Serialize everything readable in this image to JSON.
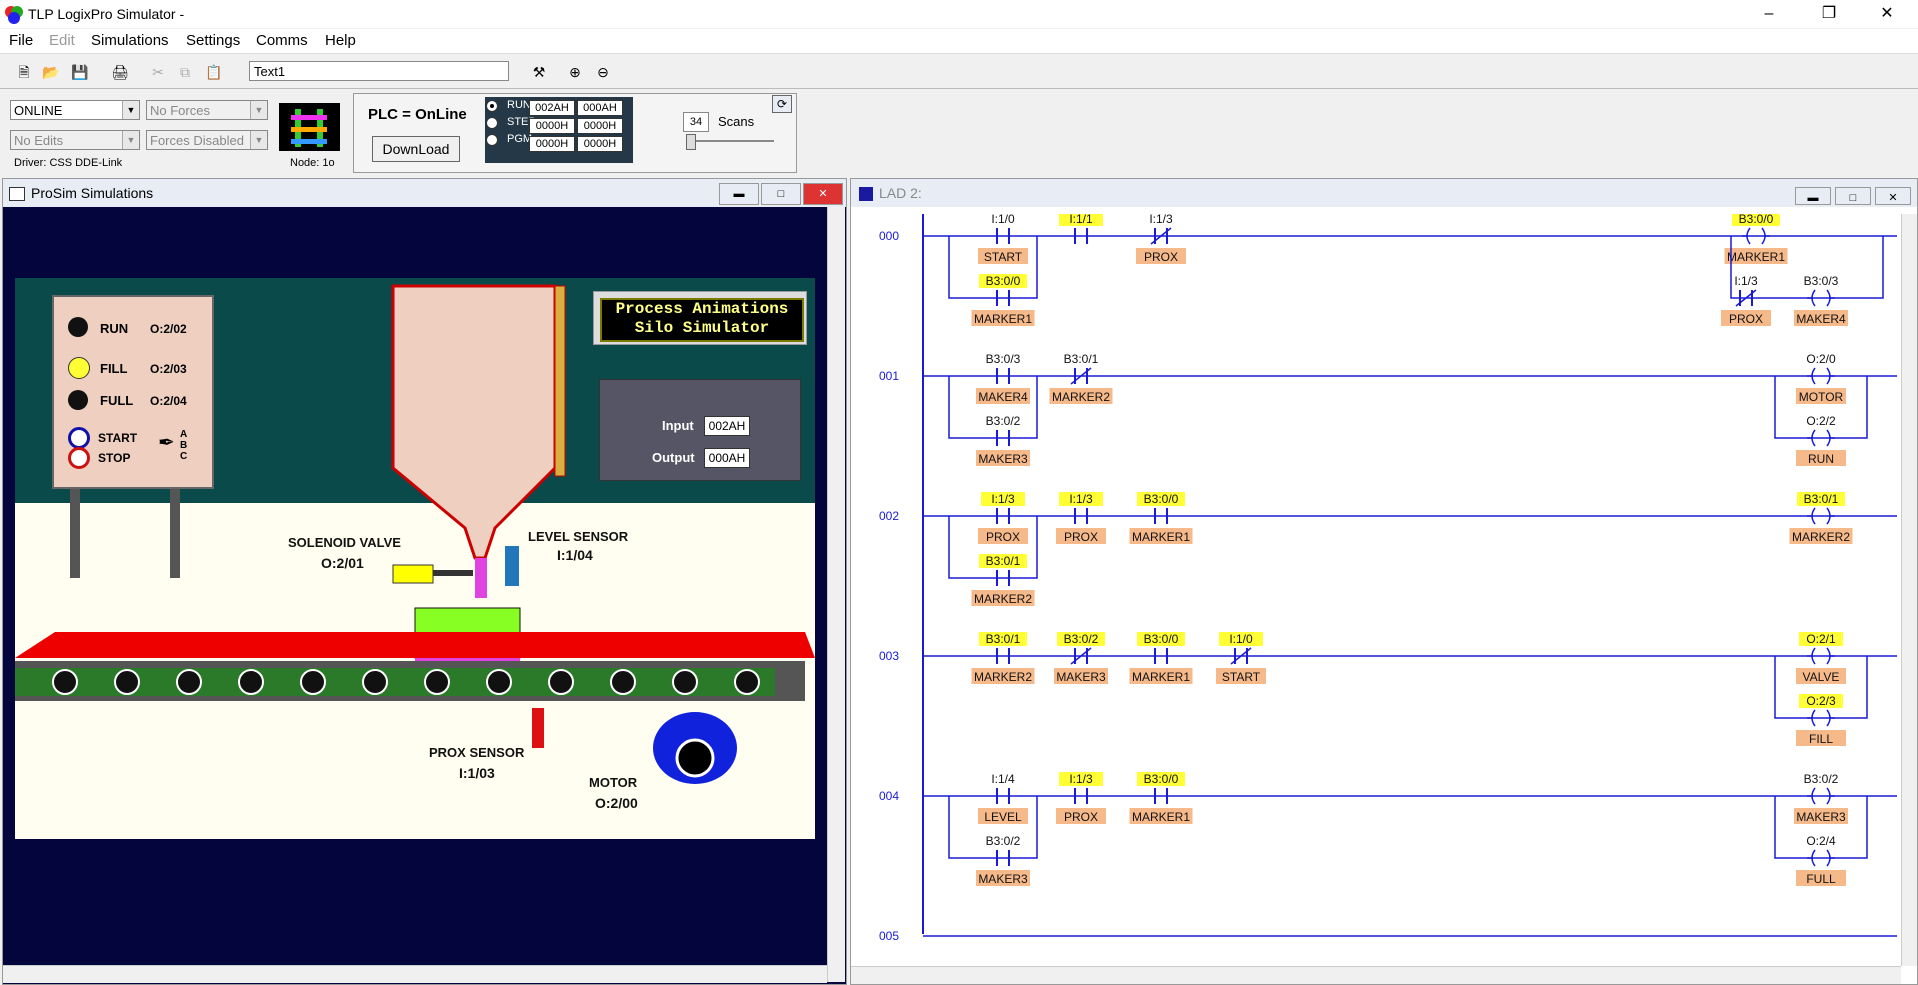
{
  "app": {
    "title": "TLP LogixPro Simulator  -"
  },
  "menu": [
    "File",
    "Edit",
    "Simulations",
    "Settings",
    "Comms",
    "Help"
  ],
  "toolbar": {
    "text_field": "Text1"
  },
  "control": {
    "mode_value": "ONLINE",
    "edits_value": "No Edits",
    "forces_value": "No Forces",
    "forces_enabled_value": "Forces Disabled",
    "driver": "Driver:  CSS DDE-Link",
    "node": "Node: 1o",
    "plc_status": "PLC = OnLine",
    "download_label": "DownLoad",
    "run_label": "RUN",
    "step_label": "STEP",
    "pgm_label": "PGM",
    "hex": [
      "002AH",
      "000AH",
      "0000H",
      "0000H",
      "0000H",
      "0000H"
    ],
    "scans_value": "34",
    "scans_label": "Scans"
  },
  "prosim": {
    "title": "ProSim Simulations",
    "banner_line1": "Process Animations",
    "banner_line2": "Silo Simulator",
    "lamps": [
      {
        "label": "RUN",
        "addr": "O:2/02",
        "color": "#111111"
      },
      {
        "label": "FILL",
        "addr": "O:2/03",
        "color": "#ffff33"
      },
      {
        "label": "FULL",
        "addr": "O:2/04",
        "color": "#111111"
      }
    ],
    "start_label": "START",
    "stop_label": "STOP",
    "abc": "A\nB\nC",
    "input_label": "Input",
    "input_value": "002AH",
    "output_label": "Output",
    "output_value": "000AH",
    "solenoid_label": "SOLENOID VALVE",
    "solenoid_addr": "O:2/01",
    "level_label": "LEVEL SENSOR",
    "level_addr": "I:1/04",
    "prox_label": "PROX SENSOR",
    "prox_addr": "I:1/03",
    "motor_label": "MOTOR",
    "motor_addr": "O:2/00"
  },
  "lad": {
    "title": "LAD 2:",
    "rungs": [
      {
        "num": "000",
        "contacts": [
          {
            "addr": "I:1/0",
            "name": "START",
            "type": "NO",
            "hl": false
          },
          {
            "addr": "I:1/1",
            "name": "",
            "type": "NO",
            "hl": true
          },
          {
            "addr": "B3:0/0",
            "name": "MARKER1",
            "type": "NO",
            "hl": true,
            "branch": true
          },
          {
            "addr": "I:1/3",
            "name": "PROX",
            "type": "NC",
            "hl": false,
            "out_branch": true
          },
          {
            "addr": "B3:0/3",
            "name": "MAKER4",
            "type": "OTE",
            "hl": false,
            "out_branch": true
          },
          {
            "addr": "B3:0/0",
            "name": "MARKER1",
            "type": "OTE",
            "hl": true
          }
        ]
      },
      {
        "num": "001",
        "contacts": [
          {
            "addr": "B3:0/3",
            "name": "MAKER4",
            "type": "NO",
            "hl": false
          },
          {
            "addr": "B3:0/1",
            "name": "MARKER2",
            "type": "NC",
            "hl": false
          },
          {
            "addr": "B3:0/2",
            "name": "MAKER3",
            "type": "NO",
            "hl": false,
            "branch": true
          },
          {
            "addr": "O:2/0",
            "name": "MOTOR",
            "type": "OTE",
            "hl": false
          },
          {
            "addr": "O:2/2",
            "name": "RUN",
            "type": "OTE",
            "hl": false
          }
        ]
      },
      {
        "num": "002",
        "contacts": [
          {
            "addr": "I:1/3",
            "name": "PROX",
            "type": "NO",
            "hl": true
          },
          {
            "addr": "I:1/3",
            "name": "PROX",
            "type": "NO",
            "hl": true
          },
          {
            "addr": "B3:0/0",
            "name": "MARKER1",
            "type": "NO",
            "hl": true
          },
          {
            "addr": "B3:0/1",
            "name": "MARKER2",
            "type": "NO",
            "hl": true,
            "branch": true
          },
          {
            "addr": "B3:0/1",
            "name": "MARKER2",
            "type": "OTE",
            "hl": true
          }
        ]
      },
      {
        "num": "003",
        "contacts": [
          {
            "addr": "B3:0/1",
            "name": "MARKER2",
            "type": "NO",
            "hl": true
          },
          {
            "addr": "B3:0/2",
            "name": "MAKER3",
            "type": "NC",
            "hl": true
          },
          {
            "addr": "B3:0/0",
            "name": "MARKER1",
            "type": "NO",
            "hl": true
          },
          {
            "addr": "I:1/0",
            "name": "START",
            "type": "NC",
            "hl": true
          },
          {
            "addr": "O:2/1",
            "name": "VALVE",
            "type": "OTE",
            "hl": true
          },
          {
            "addr": "O:2/3",
            "name": "FILL",
            "type": "OTE",
            "hl": true
          }
        ]
      },
      {
        "num": "004",
        "contacts": [
          {
            "addr": "I:1/4",
            "name": "LEVEL",
            "type": "NO",
            "hl": false
          },
          {
            "addr": "I:1/3",
            "name": "PROX",
            "type": "NO",
            "hl": true
          },
          {
            "addr": "B3:0/0",
            "name": "MARKER1",
            "type": "NO",
            "hl": true
          },
          {
            "addr": "B3:0/2",
            "name": "MAKER3",
            "type": "NO",
            "hl": false,
            "branch": true
          },
          {
            "addr": "B3:0/2",
            "name": "MAKER3",
            "type": "OTE",
            "hl": false
          },
          {
            "addr": "O:2/4",
            "name": "FULL",
            "type": "OTE",
            "hl": false
          }
        ]
      },
      {
        "num": "005",
        "contacts": []
      }
    ]
  },
  "colors": {
    "rung_line": "#1a1ad6",
    "highlight": "#ffff33",
    "tag_bg": "#f6b98a",
    "sim_bg": "#05053d"
  }
}
